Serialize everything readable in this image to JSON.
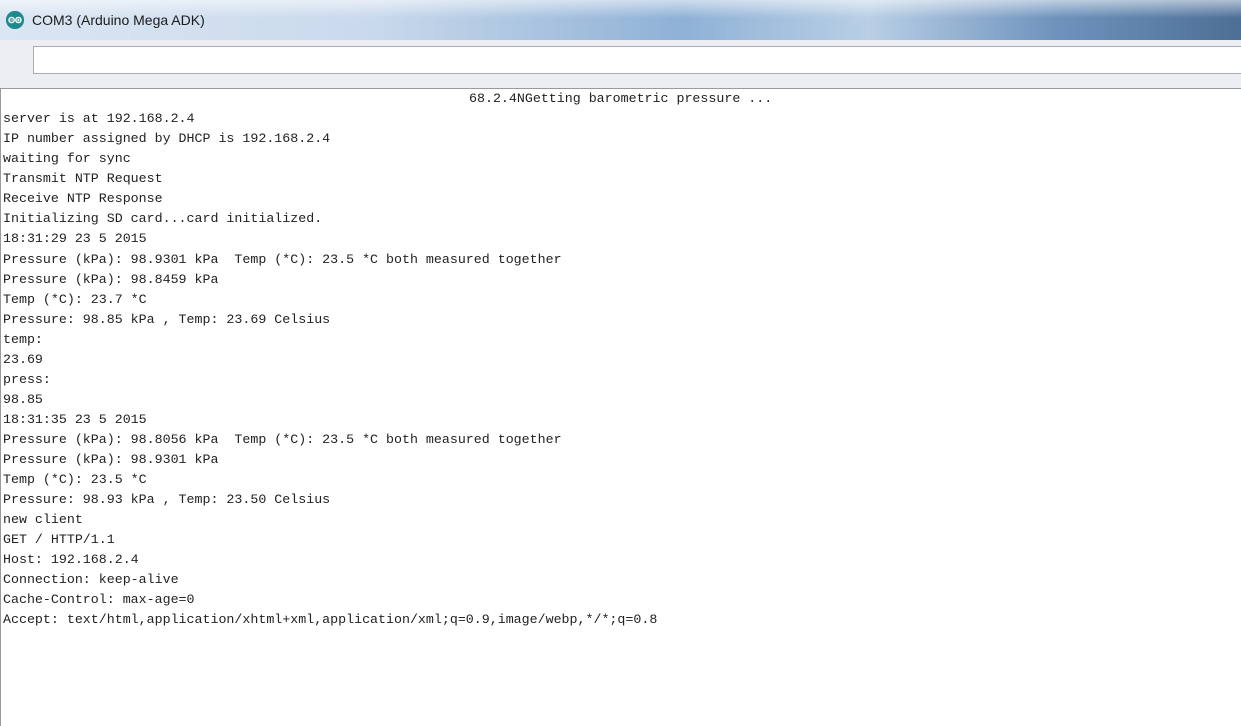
{
  "window": {
    "title": "COM3 (Arduino Mega ADK)"
  },
  "send": {
    "value": ""
  },
  "serial_output": [
    "68.2.4NGetting barometric pressure ...",
    "server is at 192.168.2.4",
    "IP number assigned by DHCP is 192.168.2.4",
    "waiting for sync",
    "Transmit NTP Request",
    "Receive NTP Response",
    "Initializing SD card...card initialized.",
    "18:31:29 23 5 2015",
    "Pressure (kPa): 98.9301 kPa  Temp (*C): 23.5 *C both measured together",
    "Pressure (kPa): 98.8459 kPa",
    "Temp (*C): 23.7 *C",
    "Pressure: 98.85 kPa , Temp: 23.69 Celsius",
    "temp:",
    "23.69",
    "press:",
    "98.85",
    "18:31:35 23 5 2015",
    "Pressure (kPa): 98.8056 kPa  Temp (*C): 23.5 *C both measured together",
    "Pressure (kPa): 98.9301 kPa",
    "Temp (*C): 23.5 *C",
    "Pressure: 98.93 kPa , Temp: 23.50 Celsius",
    "new client",
    "GET / HTTP/1.1",
    "Host: 192.168.2.4",
    "Connection: keep-alive",
    "Cache-Control: max-age=0",
    "Accept: text/html,application/xhtml+xml,application/xml;q=0.9,image/webp,*/*;q=0.8"
  ]
}
